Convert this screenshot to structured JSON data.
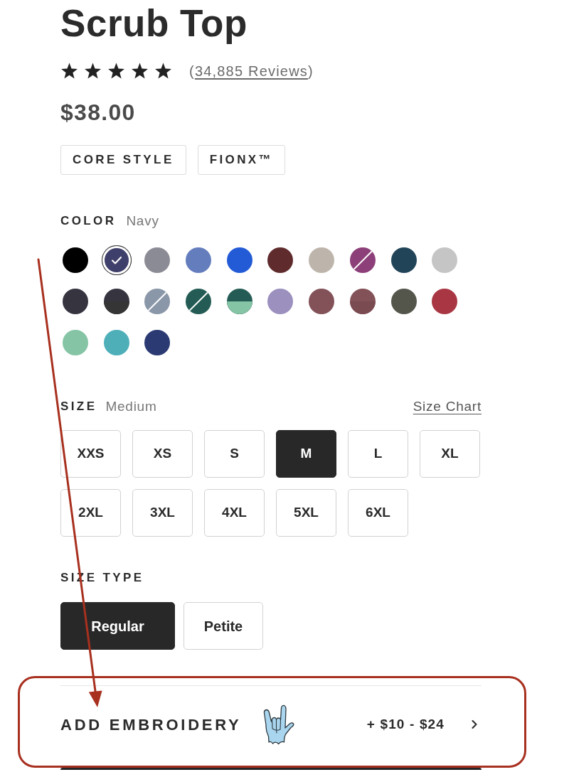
{
  "product": {
    "title": "Scrub Top"
  },
  "rating": {
    "stars": 5,
    "reviews_link": {
      "open": "(",
      "label": "34,885 Reviews",
      "close": ")"
    }
  },
  "price": "$38.00",
  "tags": [
    "CORE STYLE",
    "FIONX™"
  ],
  "color": {
    "label": "COLOR",
    "value": "Navy",
    "swatches": [
      {
        "kind": "solid",
        "color": "#000000",
        "selected": false
      },
      {
        "kind": "solid",
        "color": "#3f3f6b",
        "selected": true
      },
      {
        "kind": "solid",
        "color": "#8b8b95",
        "selected": false
      },
      {
        "kind": "solid",
        "color": "#647dbd",
        "selected": false
      },
      {
        "kind": "solid",
        "color": "#235bd6",
        "selected": false
      },
      {
        "kind": "solid",
        "color": "#5f2b2d",
        "selected": false
      },
      {
        "kind": "solid",
        "color": "#bdb5ab",
        "selected": false
      },
      {
        "kind": "diagonal",
        "color": "#8c3f78",
        "selected": false
      },
      {
        "kind": "solid",
        "color": "#224459",
        "selected": false
      },
      {
        "kind": "solid",
        "color": "#c4c5c4",
        "selected": false
      },
      {
        "kind": "solid",
        "color": "#36343f",
        "selected": false
      },
      {
        "kind": "split",
        "color": "#36343f",
        "lower": {
          "color": "#353535"
        },
        "selected": false
      },
      {
        "kind": "diagonal",
        "color": "#8a97a8",
        "selected": false
      },
      {
        "kind": "diagonal",
        "color": "#245c55",
        "selected": false
      },
      {
        "kind": "split",
        "color": "#245c55",
        "lower": {
          "color": "#85c4a5"
        },
        "selected": false
      },
      {
        "kind": "solid",
        "color": "#9b90be",
        "selected": false
      },
      {
        "kind": "solid",
        "color": "#835158",
        "selected": false
      },
      {
        "kind": "split",
        "color": "#835158",
        "lower": {
          "color": "#7b4b52"
        },
        "selected": false
      },
      {
        "kind": "solid",
        "color": "#54554b",
        "selected": false
      },
      {
        "kind": "solid",
        "color": "#a83743",
        "selected": false
      },
      {
        "kind": "solid",
        "color": "#85c4a5",
        "selected": false
      },
      {
        "kind": "solid",
        "color": "#4eafb9",
        "selected": false
      },
      {
        "kind": "solid",
        "color": "#2b3a73",
        "selected": false
      }
    ]
  },
  "size": {
    "label": "SIZE",
    "value": "Medium",
    "chart_link": "Size Chart",
    "options": [
      {
        "label": "XXS",
        "selected": false
      },
      {
        "label": "XS",
        "selected": false
      },
      {
        "label": "S",
        "selected": false
      },
      {
        "label": "M",
        "selected": true
      },
      {
        "label": "L",
        "selected": false
      },
      {
        "label": "XL",
        "selected": false
      },
      {
        "label": "2XL",
        "selected": false
      },
      {
        "label": "3XL",
        "selected": false
      },
      {
        "label": "4XL",
        "selected": false
      },
      {
        "label": "5XL",
        "selected": false
      },
      {
        "label": "6XL",
        "selected": false
      }
    ]
  },
  "size_type": {
    "label": "SIZE TYPE",
    "options": [
      {
        "label": "Regular",
        "selected": true
      },
      {
        "label": "Petite",
        "selected": false
      }
    ]
  },
  "embroidery": {
    "label": "ADD EMBROIDERY",
    "price": "+ $10 - $24"
  }
}
